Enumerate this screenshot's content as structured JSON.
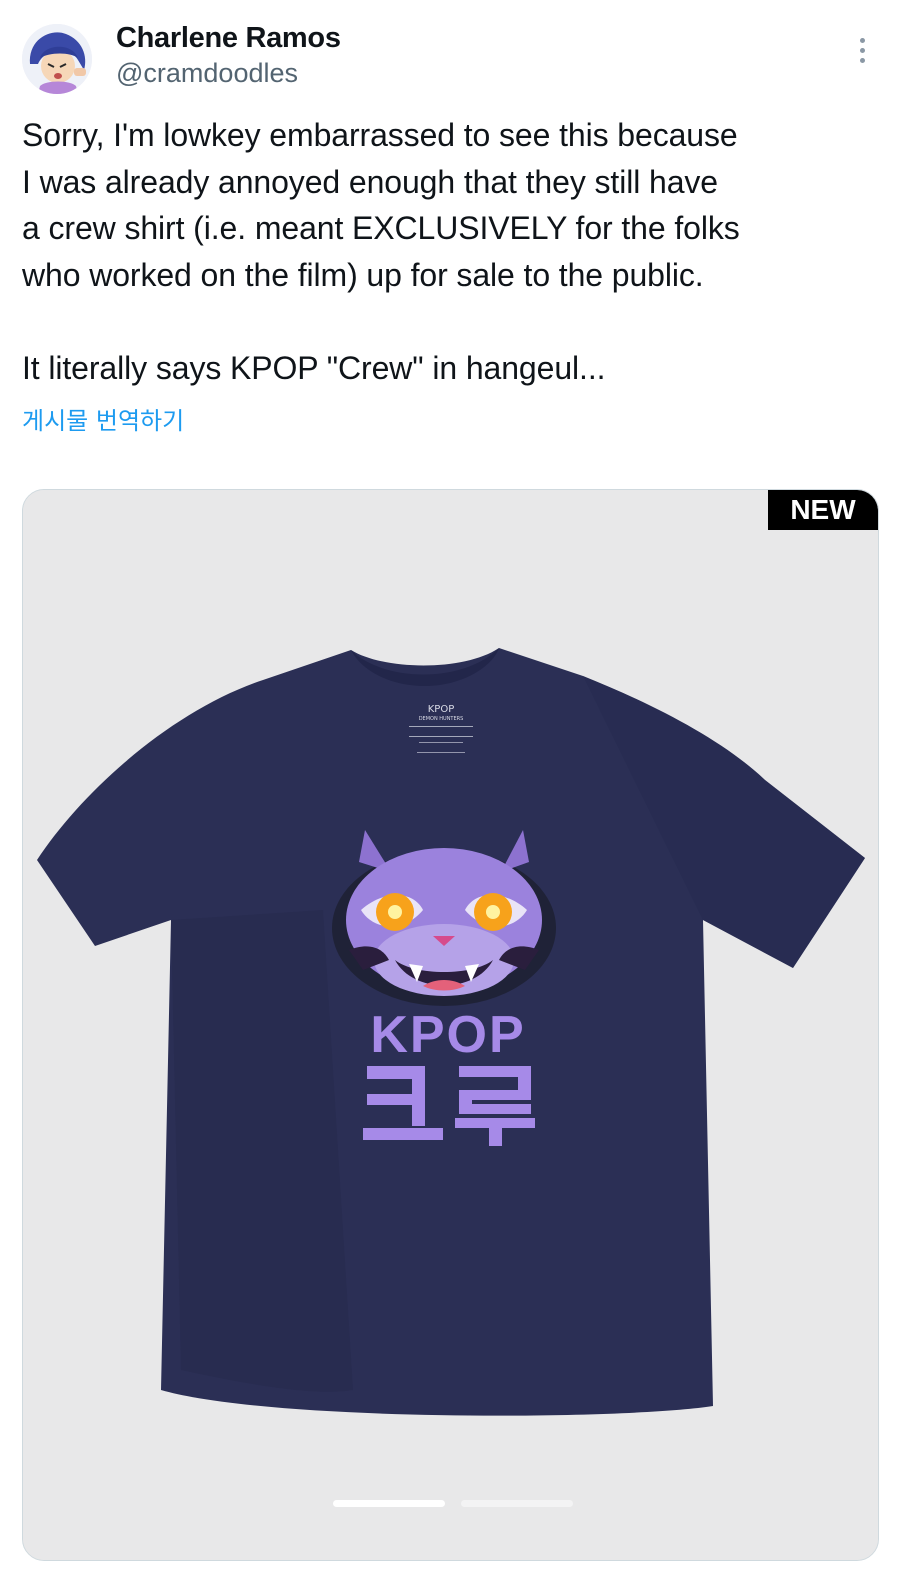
{
  "author": {
    "name": "Charlene Ramos",
    "handle": "@cramdoodles"
  },
  "tweet": {
    "text": "Sorry, I'm lowkey embarrassed to see this because\nI was already annoyed enough that they still have\na crew shirt (i.e. meant EXCLUSIVELY for the folks\nwho worked on the film) up for sale to the public.\n\nIt literally says KPOP \"Crew\" in hangeul...",
    "translate_label": "게시물 번역하기"
  },
  "media": {
    "badge": "NEW",
    "shirt_text": {
      "line1": "KPOP",
      "line2": "크루",
      "tag_brand": "KPOP",
      "tag_sub": "DEMON HUNTERS"
    },
    "carousel": {
      "count": 2,
      "active": 1
    }
  },
  "colors": {
    "link": "#1d9bf0",
    "shirt": "#2b2f55",
    "print": "#9b82dd"
  },
  "icons": {
    "more": "more-vertical-icon"
  }
}
